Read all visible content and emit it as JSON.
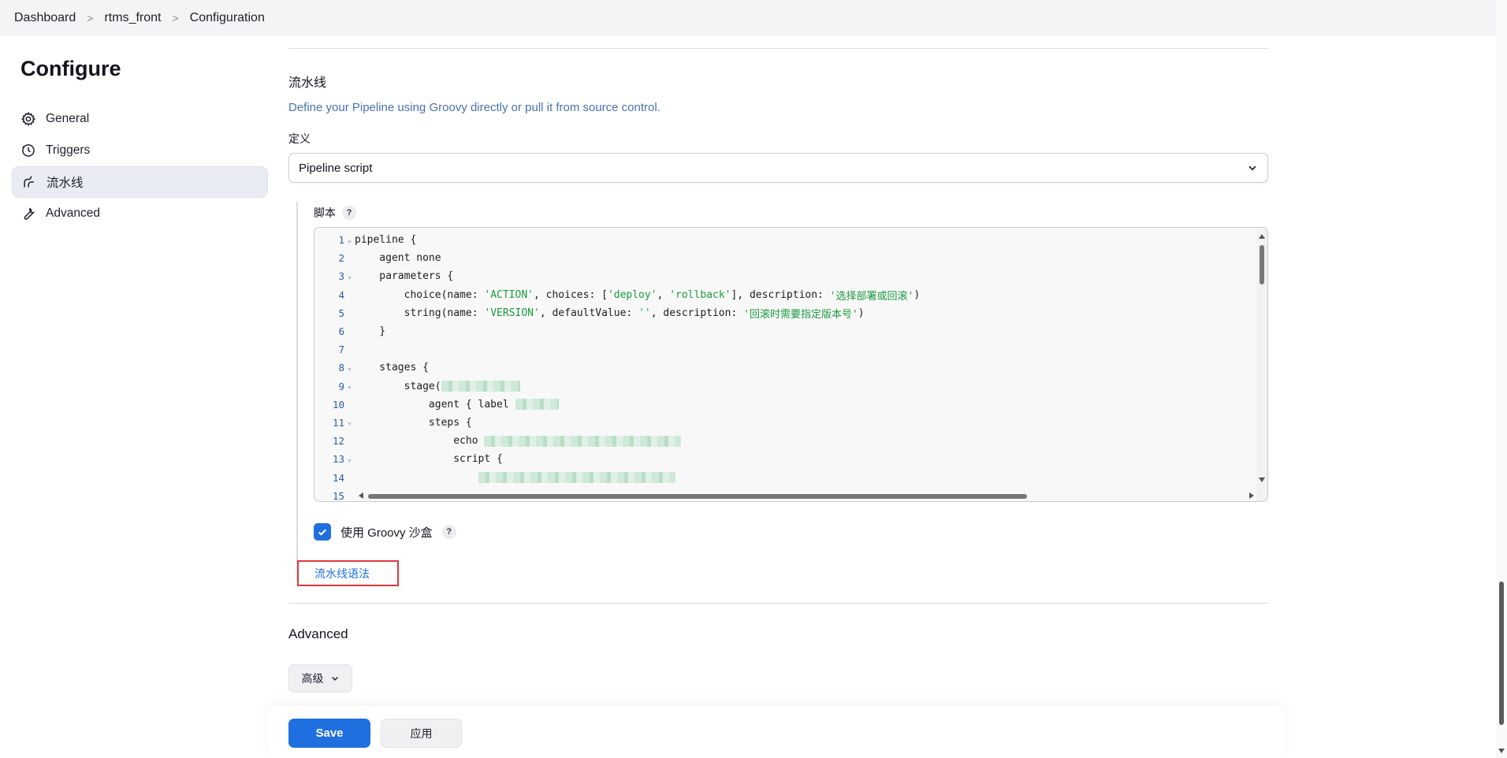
{
  "breadcrumb": {
    "items": [
      "Dashboard",
      "rtms_front",
      "Configuration"
    ],
    "separator": ">"
  },
  "sidebar": {
    "title": "Configure",
    "items": [
      {
        "label": "General",
        "icon": "gear-icon"
      },
      {
        "label": "Triggers",
        "icon": "clock-icon"
      },
      {
        "label": "流水线",
        "icon": "pipeline-icon",
        "active": true
      },
      {
        "label": "Advanced",
        "icon": "wrench-icon"
      }
    ]
  },
  "pipeline": {
    "title": "流水线",
    "description": "Define your Pipeline using Groovy directly or pull it from source control.",
    "definition_label": "定义",
    "definition_value": "Pipeline script",
    "script_label": "脚本",
    "help": "?",
    "code": [
      {
        "n": "1",
        "fold": true,
        "parts": [
          [
            "",
            "pipeline {"
          ]
        ]
      },
      {
        "n": "2",
        "fold": false,
        "parts": [
          [
            "",
            "    agent none"
          ]
        ]
      },
      {
        "n": "3",
        "fold": true,
        "parts": [
          [
            "",
            "    parameters {"
          ]
        ]
      },
      {
        "n": "4",
        "fold": false,
        "parts": [
          [
            "",
            "        choice(name: "
          ],
          [
            "str",
            "'ACTION'"
          ],
          [
            "",
            ", choices: ["
          ],
          [
            "str",
            "'deploy'"
          ],
          [
            "",
            ", "
          ],
          [
            "str",
            "'rollback'"
          ],
          [
            "",
            "], description: "
          ],
          [
            "str",
            "'选择部署或回滚'"
          ],
          [
            "",
            ")"
          ]
        ]
      },
      {
        "n": "5",
        "fold": false,
        "parts": [
          [
            "",
            "        string(name: "
          ],
          [
            "str",
            "'VERSION'"
          ],
          [
            "",
            ", defaultValue: "
          ],
          [
            "str",
            "''"
          ],
          [
            "",
            ", description: "
          ],
          [
            "str",
            "'回滚时需要指定版本号'"
          ],
          [
            "",
            ")"
          ]
        ]
      },
      {
        "n": "6",
        "fold": false,
        "parts": [
          [
            "",
            "    }"
          ]
        ]
      },
      {
        "n": "7",
        "fold": false,
        "parts": [
          [
            "",
            ""
          ]
        ]
      },
      {
        "n": "8",
        "fold": true,
        "parts": [
          [
            "",
            "    stages {"
          ]
        ]
      },
      {
        "n": "9",
        "fold": true,
        "parts": [
          [
            "",
            "        stage("
          ],
          [
            "blur",
            "100"
          ]
        ]
      },
      {
        "n": "10",
        "fold": false,
        "parts": [
          [
            "",
            "            agent { label "
          ],
          [
            "blur",
            "55"
          ]
        ]
      },
      {
        "n": "11",
        "fold": true,
        "parts": [
          [
            "",
            "            steps {"
          ]
        ]
      },
      {
        "n": "12",
        "fold": false,
        "parts": [
          [
            "",
            "                echo "
          ],
          [
            "blur",
            "250"
          ]
        ]
      },
      {
        "n": "13",
        "fold": true,
        "parts": [
          [
            "",
            "                script {"
          ]
        ]
      },
      {
        "n": "14",
        "fold": false,
        "parts": [
          [
            "",
            "                    "
          ],
          [
            "blur",
            "250"
          ]
        ]
      },
      {
        "n": "15",
        "fold": false,
        "parts": [
          [
            "",
            ""
          ]
        ]
      }
    ],
    "sandbox_label": "使用 Groovy 沙盒",
    "sandbox_checked": true,
    "syntax_link": "流水线语法"
  },
  "advanced": {
    "title": "Advanced",
    "button_label": "高级"
  },
  "actions": {
    "save_label": "Save",
    "apply_label": "应用"
  },
  "colors": {
    "accent": "#1f6fe0",
    "string": "#1b9a3e",
    "highlight_box": "#e0393e"
  }
}
